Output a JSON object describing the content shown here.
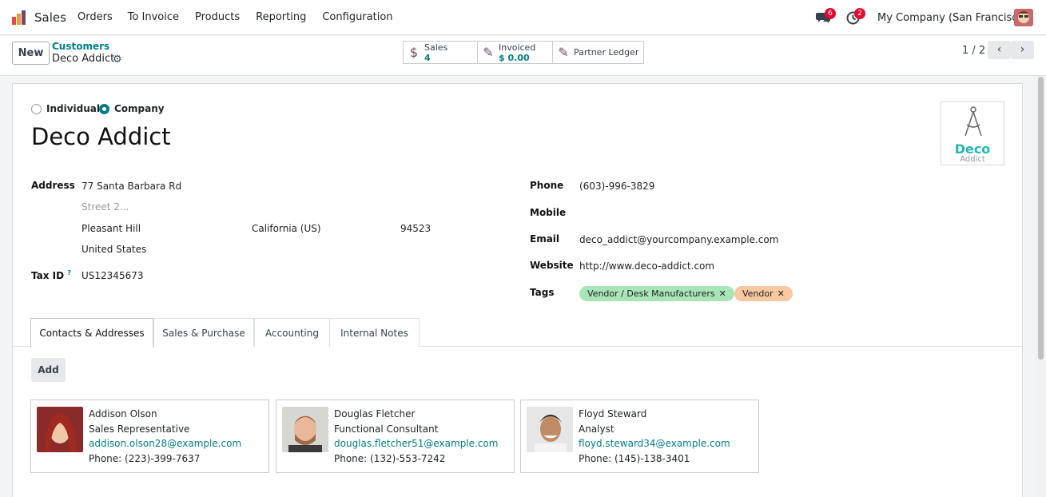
{
  "nav": {
    "app_name": "Sales",
    "menu": [
      "Orders",
      "To Invoice",
      "Products",
      "Reporting",
      "Configuration"
    ],
    "chat_count": "6",
    "activity_count": "2",
    "company": "My Company (San Francisco)"
  },
  "control": {
    "new_label": "New",
    "breadcrumb_parent": "Customers",
    "breadcrumb_current": "Deco Addict",
    "smart_buttons": [
      {
        "label": "Sales",
        "value": "4",
        "icon": "dollar-icon"
      },
      {
        "label": "Invoiced",
        "value": "$ 0.00",
        "icon": "edit-icon"
      },
      {
        "label": "Partner Ledger",
        "value": "",
        "icon": "edit-icon"
      }
    ],
    "pager": "1 / 2"
  },
  "form": {
    "type_individual": "Individual",
    "type_company": "Company",
    "name": "Deco Addict",
    "logo_top": "Deco",
    "logo_bottom": "Addict",
    "address_label": "Address",
    "street": "77 Santa Barbara Rd",
    "street2_placeholder": "Street 2...",
    "city": "Pleasant Hill",
    "state": "California (US)",
    "zip": "94523",
    "country": "United States",
    "taxid_label": "Tax ID",
    "taxid_help": "?",
    "taxid": "US12345673",
    "phone_label": "Phone",
    "phone": "(603)-996-3829",
    "mobile_label": "Mobile",
    "mobile": "",
    "email_label": "Email",
    "email": "deco_addict@yourcompany.example.com",
    "website_label": "Website",
    "website": "http://www.deco-addict.com",
    "tags_label": "Tags",
    "tags": [
      {
        "label": "Vendor / Desk Manufacturers",
        "color": "#a8e6b8"
      },
      {
        "label": "Vendor",
        "color": "#f8c8a0"
      }
    ]
  },
  "tabs": [
    "Contacts & Addresses",
    "Sales & Purchase",
    "Accounting",
    "Internal Notes"
  ],
  "add_label": "Add",
  "contacts": [
    {
      "name": "Addison Olson",
      "title": "Sales Representative",
      "email": "addison.olson28@example.com",
      "phone": "Phone: (223)-399-7637"
    },
    {
      "name": "Douglas Fletcher",
      "title": "Functional Consultant",
      "email": "douglas.fletcher51@example.com",
      "phone": "Phone: (132)-553-7242"
    },
    {
      "name": "Floyd Steward",
      "title": "Analyst",
      "email": "floyd.steward34@example.com",
      "phone": "Phone: (145)-138-3401"
    }
  ],
  "colors": {
    "accent": "#017e84",
    "brand": "#714b67",
    "badge": "#e4092f"
  }
}
